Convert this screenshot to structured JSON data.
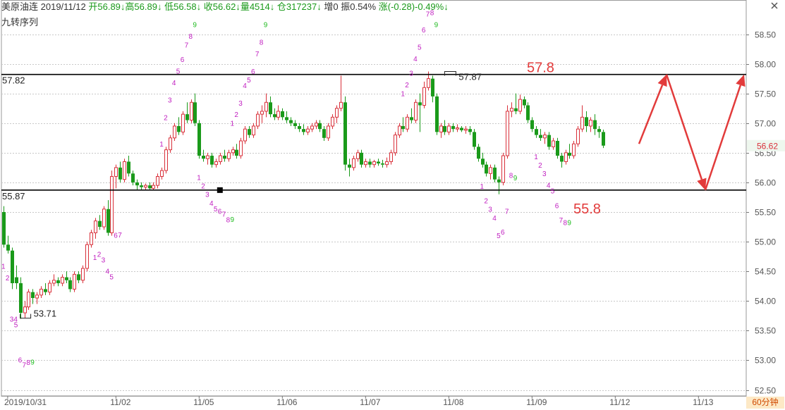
{
  "header": {
    "symbol": "美原油连",
    "date": "2019/11/12",
    "open": "开56.89↓",
    "high": "高56.89↓",
    "low": "低56.58↓",
    "close": "收56.62↓",
    "volume": "量4514↓",
    "oi": "仓317237↓",
    "oi_change": "增0",
    "amplitude": "振0.54%",
    "change": "涨(-0.28)-0.49%↓"
  },
  "subtitle": "九转序列",
  "period": "60分钟",
  "colors": {
    "up": "#d9303a",
    "down": "#1a9a1a",
    "magenta": "#c020c0",
    "green_count": "#22bb22",
    "annot_red": "#e23b3b",
    "price_tag_green": "#1a9a1a"
  },
  "chart_data": {
    "type": "candlestick",
    "y_ticks": [
      "58.50",
      "58.00",
      "57.50",
      "57.00",
      "56.50",
      "56.00",
      "55.50",
      "55.00",
      "54.50",
      "54.00",
      "53.50",
      "53.00",
      "52.50"
    ],
    "ylim": [
      52.4,
      58.8
    ],
    "x_labels": [
      "2019/10/31",
      "11/02",
      "11/05",
      "11/06",
      "11/07",
      "11/08",
      "11/09",
      "11/12",
      "11/13"
    ],
    "last_price": "56.62",
    "h_lines": [
      {
        "value": 57.82,
        "label": "57.82"
      },
      {
        "value": 55.87,
        "label": "55.87"
      }
    ],
    "extreme_labels": [
      {
        "value": 53.71,
        "label": "53.71"
      },
      {
        "value": 57.87,
        "label": "57.87"
      }
    ],
    "annotations": [
      {
        "text": "57.8",
        "value": 57.8
      },
      {
        "text": "55.8",
        "value": 55.8
      }
    ],
    "forecast_path": [
      56.65,
      57.82,
      55.87,
      57.82
    ],
    "candles": [
      [
        55.5,
        55.6,
        54.9,
        54.95
      ],
      [
        54.95,
        55.1,
        54.8,
        54.85
      ],
      [
        54.85,
        54.9,
        54.2,
        54.3
      ],
      [
        54.4,
        54.6,
        54.2,
        54.3
      ],
      [
        54.3,
        54.4,
        53.7,
        53.8
      ],
      [
        53.8,
        54.0,
        53.71,
        53.9
      ],
      [
        53.9,
        54.2,
        53.85,
        54.15
      ],
      [
        54.15,
        54.2,
        53.95,
        54.05
      ],
      [
        54.05,
        54.15,
        53.95,
        54.1
      ],
      [
        54.1,
        54.25,
        54.05,
        54.2
      ],
      [
        54.2,
        54.3,
        54.1,
        54.15
      ],
      [
        54.15,
        54.35,
        54.1,
        54.3
      ],
      [
        54.3,
        54.45,
        54.25,
        54.35
      ],
      [
        54.35,
        54.4,
        54.25,
        54.3
      ],
      [
        54.3,
        54.45,
        54.25,
        54.4
      ],
      [
        54.4,
        54.5,
        54.3,
        54.35
      ],
      [
        54.35,
        54.4,
        54.15,
        54.2
      ],
      [
        54.2,
        54.5,
        54.15,
        54.45
      ],
      [
        54.45,
        54.5,
        54.3,
        54.35
      ],
      [
        54.35,
        54.6,
        54.3,
        54.55
      ],
      [
        54.55,
        55.0,
        54.5,
        54.95
      ],
      [
        54.95,
        55.2,
        54.9,
        55.15
      ],
      [
        55.15,
        55.4,
        55.05,
        55.35
      ],
      [
        55.35,
        55.45,
        55.2,
        55.25
      ],
      [
        55.25,
        55.6,
        55.2,
        55.55
      ],
      [
        55.55,
        55.7,
        55.1,
        55.15
      ],
      [
        55.15,
        56.2,
        55.1,
        56.1
      ],
      [
        56.1,
        56.3,
        55.9,
        56.25
      ],
      [
        56.25,
        56.35,
        56.0,
        56.05
      ],
      [
        56.05,
        56.4,
        56.0,
        56.35
      ],
      [
        56.35,
        56.45,
        56.1,
        56.15
      ],
      [
        56.15,
        56.2,
        55.95,
        56.0
      ],
      [
        56.0,
        56.05,
        55.88,
        55.95
      ],
      [
        55.95,
        56.0,
        55.87,
        55.92
      ],
      [
        55.92,
        55.98,
        55.87,
        55.95
      ],
      [
        55.95,
        56.0,
        55.87,
        55.9
      ],
      [
        55.9,
        56.0,
        55.87,
        55.95
      ],
      [
        55.95,
        56.15,
        55.9,
        56.1
      ],
      [
        56.1,
        56.25,
        56.05,
        56.2
      ],
      [
        56.2,
        56.6,
        56.15,
        56.55
      ],
      [
        56.55,
        56.8,
        56.5,
        56.75
      ],
      [
        56.75,
        57.0,
        56.7,
        56.95
      ],
      [
        56.95,
        57.1,
        56.8,
        56.85
      ],
      [
        56.85,
        57.2,
        56.8,
        57.15
      ],
      [
        57.15,
        57.35,
        57.0,
        57.05
      ],
      [
        57.05,
        57.4,
        57.0,
        57.35
      ],
      [
        57.35,
        57.5,
        56.95,
        57.0
      ],
      [
        57.0,
        57.05,
        56.4,
        56.45
      ],
      [
        56.45,
        56.55,
        56.35,
        56.4
      ],
      [
        56.4,
        56.5,
        56.3,
        56.45
      ],
      [
        56.45,
        56.5,
        56.25,
        56.3
      ],
      [
        56.3,
        56.4,
        56.25,
        56.35
      ],
      [
        56.35,
        56.5,
        56.3,
        56.45
      ],
      [
        56.45,
        56.55,
        56.35,
        56.4
      ],
      [
        56.4,
        56.55,
        56.35,
        56.5
      ],
      [
        56.5,
        56.6,
        56.45,
        56.55
      ],
      [
        56.55,
        56.65,
        56.4,
        56.45
      ],
      [
        56.45,
        56.75,
        56.4,
        56.7
      ],
      [
        56.7,
        56.95,
        56.65,
        56.9
      ],
      [
        56.9,
        56.95,
        56.75,
        56.8
      ],
      [
        56.8,
        57.0,
        56.75,
        56.95
      ],
      [
        56.95,
        57.2,
        56.9,
        57.15
      ],
      [
        57.15,
        57.3,
        57.0,
        57.2
      ],
      [
        57.2,
        57.5,
        57.1,
        57.35
      ],
      [
        57.35,
        57.45,
        57.1,
        57.15
      ],
      [
        57.15,
        57.25,
        57.05,
        57.1
      ],
      [
        57.1,
        57.3,
        57.05,
        57.2
      ],
      [
        57.2,
        57.25,
        57.05,
        57.1
      ],
      [
        57.1,
        57.2,
        57.0,
        57.05
      ],
      [
        57.05,
        57.1,
        56.95,
        57.0
      ],
      [
        57.0,
        57.05,
        56.9,
        56.95
      ],
      [
        56.95,
        57.0,
        56.85,
        56.9
      ],
      [
        56.9,
        56.98,
        56.8,
        56.85
      ],
      [
        56.85,
        56.95,
        56.8,
        56.9
      ],
      [
        56.9,
        57.0,
        56.85,
        56.95
      ],
      [
        56.95,
        57.05,
        56.9,
        57.0
      ],
      [
        57.0,
        57.05,
        56.85,
        56.9
      ],
      [
        56.9,
        56.95,
        56.7,
        56.75
      ],
      [
        56.75,
        57.0,
        56.7,
        56.95
      ],
      [
        56.95,
        57.15,
        56.9,
        57.1
      ],
      [
        57.1,
        57.3,
        57.0,
        57.25
      ],
      [
        57.25,
        57.8,
        57.2,
        57.35
      ],
      [
        57.35,
        57.45,
        56.2,
        56.3
      ],
      [
        56.3,
        56.4,
        56.1,
        56.25
      ],
      [
        56.25,
        56.45,
        56.2,
        56.4
      ],
      [
        56.4,
        56.55,
        56.35,
        56.5
      ],
      [
        56.5,
        56.55,
        56.25,
        56.3
      ],
      [
        56.3,
        56.4,
        56.25,
        56.35
      ],
      [
        56.35,
        56.4,
        56.25,
        56.3
      ],
      [
        56.3,
        56.38,
        56.25,
        56.35
      ],
      [
        56.35,
        56.4,
        56.28,
        56.32
      ],
      [
        56.32,
        56.38,
        56.25,
        56.3
      ],
      [
        56.3,
        56.42,
        56.25,
        56.35
      ],
      [
        56.35,
        56.55,
        56.3,
        56.5
      ],
      [
        56.5,
        56.85,
        56.45,
        56.8
      ],
      [
        56.8,
        57.0,
        56.75,
        56.95
      ],
      [
        56.95,
        57.1,
        56.85,
        56.9
      ],
      [
        56.9,
        57.15,
        56.85,
        57.1
      ],
      [
        57.1,
        57.25,
        57.0,
        57.05
      ],
      [
        57.05,
        57.4,
        57.0,
        57.35
      ],
      [
        57.35,
        57.5,
        56.85,
        57.3
      ],
      [
        57.3,
        57.7,
        57.25,
        57.6
      ],
      [
        57.6,
        57.87,
        57.55,
        57.75
      ],
      [
        57.75,
        57.8,
        57.35,
        57.45
      ],
      [
        57.45,
        57.5,
        56.8,
        56.85
      ],
      [
        56.85,
        57.0,
        56.75,
        56.95
      ],
      [
        56.95,
        57.05,
        56.8,
        56.85
      ],
      [
        56.85,
        57.0,
        56.8,
        56.95
      ],
      [
        56.95,
        57.0,
        56.85,
        56.9
      ],
      [
        56.9,
        56.98,
        56.85,
        56.92
      ],
      [
        56.92,
        56.95,
        56.85,
        56.88
      ],
      [
        56.88,
        56.95,
        56.82,
        56.9
      ],
      [
        56.9,
        56.95,
        56.8,
        56.85
      ],
      [
        56.85,
        56.9,
        56.55,
        56.6
      ],
      [
        56.6,
        56.65,
        56.35,
        56.4
      ],
      [
        56.4,
        56.5,
        56.25,
        56.3
      ],
      [
        56.3,
        56.35,
        56.1,
        56.15
      ],
      [
        56.15,
        56.3,
        56.05,
        56.25
      ],
      [
        56.25,
        56.3,
        56.0,
        56.05
      ],
      [
        56.05,
        56.1,
        55.8,
        56.0
      ],
      [
        56.0,
        56.5,
        55.95,
        56.45
      ],
      [
        56.45,
        57.3,
        56.4,
        57.2
      ],
      [
        57.2,
        57.35,
        57.1,
        57.25
      ],
      [
        57.25,
        57.5,
        57.15,
        57.2
      ],
      [
        57.2,
        57.48,
        57.15,
        57.4
      ],
      [
        57.4,
        57.45,
        57.25,
        57.3
      ],
      [
        57.3,
        57.35,
        57.0,
        57.05
      ],
      [
        57.05,
        57.1,
        56.85,
        56.9
      ],
      [
        56.9,
        56.95,
        56.75,
        56.8
      ],
      [
        56.8,
        56.9,
        56.7,
        56.75
      ],
      [
        56.75,
        56.85,
        56.65,
        56.8
      ],
      [
        56.8,
        56.85,
        56.55,
        56.6
      ],
      [
        56.6,
        56.75,
        56.55,
        56.7
      ],
      [
        56.7,
        56.75,
        56.4,
        56.45
      ],
      [
        56.45,
        56.5,
        56.25,
        56.35
      ],
      [
        56.35,
        56.55,
        56.3,
        56.5
      ],
      [
        56.5,
        56.65,
        56.4,
        56.45
      ],
      [
        56.45,
        56.7,
        56.4,
        56.65
      ],
      [
        56.65,
        56.95,
        56.6,
        56.9
      ],
      [
        56.9,
        57.3,
        56.85,
        57.1
      ],
      [
        57.1,
        57.2,
        56.85,
        56.95
      ],
      [
        56.95,
        57.1,
        56.85,
        57.05
      ],
      [
        57.05,
        57.15,
        56.8,
        56.9
      ],
      [
        56.9,
        56.95,
        56.75,
        56.85
      ],
      [
        56.85,
        56.89,
        56.58,
        56.62
      ]
    ],
    "x_label_candle": [
      1,
      27,
      47,
      67,
      87,
      107,
      127,
      147,
      167
    ],
    "td_counts": [
      {
        "c": 0,
        "side": "below",
        "seq": [
          "1",
          "2",
          "34",
          "5",
          "6",
          "7",
          "8",
          "9"
        ],
        "from": 1
      },
      {
        "c": 22,
        "side": "below",
        "seq": [
          "1",
          "2",
          "3",
          "4",
          "5",
          "6",
          "7"
        ],
        "from": 1
      },
      {
        "c": 38,
        "side": "above",
        "seq": [
          "1",
          "2",
          "3",
          "4",
          "5",
          "6",
          "7",
          "8",
          "9"
        ],
        "from": 1
      },
      {
        "c": 47,
        "side": "below",
        "seq": [
          "1",
          "2",
          "3",
          "4",
          "5",
          "6",
          "7",
          "8",
          "9"
        ],
        "from": 1
      },
      {
        "c": 55,
        "side": "above",
        "seq": [
          "1",
          "2",
          "3",
          "4",
          "5",
          "6",
          "7",
          "8",
          "9"
        ],
        "from": 1
      },
      {
        "c": 96,
        "side": "above",
        "seq": [
          "1",
          "2",
          "3",
          "4",
          "5",
          "6",
          "7",
          "8",
          "9"
        ],
        "from": 1
      },
      {
        "c": 115,
        "side": "below",
        "seq": [
          "1",
          "2",
          "3",
          "4",
          "5",
          "6",
          "7",
          "8",
          "9"
        ],
        "from": 1
      },
      {
        "c": 128,
        "side": "below",
        "seq": [
          "1",
          "2",
          "3",
          "4",
          "5",
          "6",
          "7",
          "8",
          "9"
        ],
        "from": 1
      }
    ]
  }
}
